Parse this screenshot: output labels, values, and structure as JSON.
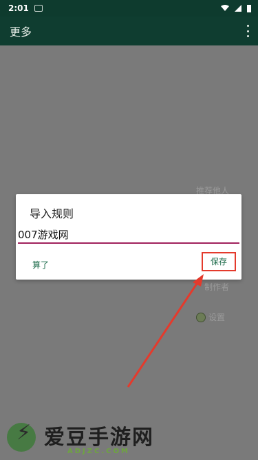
{
  "status_bar": {
    "time": "2:01"
  },
  "app_bar": {
    "title": "更多"
  },
  "background_menu": {
    "share_label": "推荐他人",
    "author_label": "制作者",
    "settings_label": "设置"
  },
  "dialog": {
    "title": "导入规则",
    "input_value": "007游戏网",
    "cancel_label": "算了",
    "save_label": "保存"
  },
  "watermark": {
    "title": "爱豆手游网",
    "url": "ADJZC.COM"
  },
  "colors": {
    "app_bar": "#0f3d30",
    "accent": "#1b6a49",
    "input_underline": "#a0205c",
    "highlight": "#e43a2c"
  }
}
